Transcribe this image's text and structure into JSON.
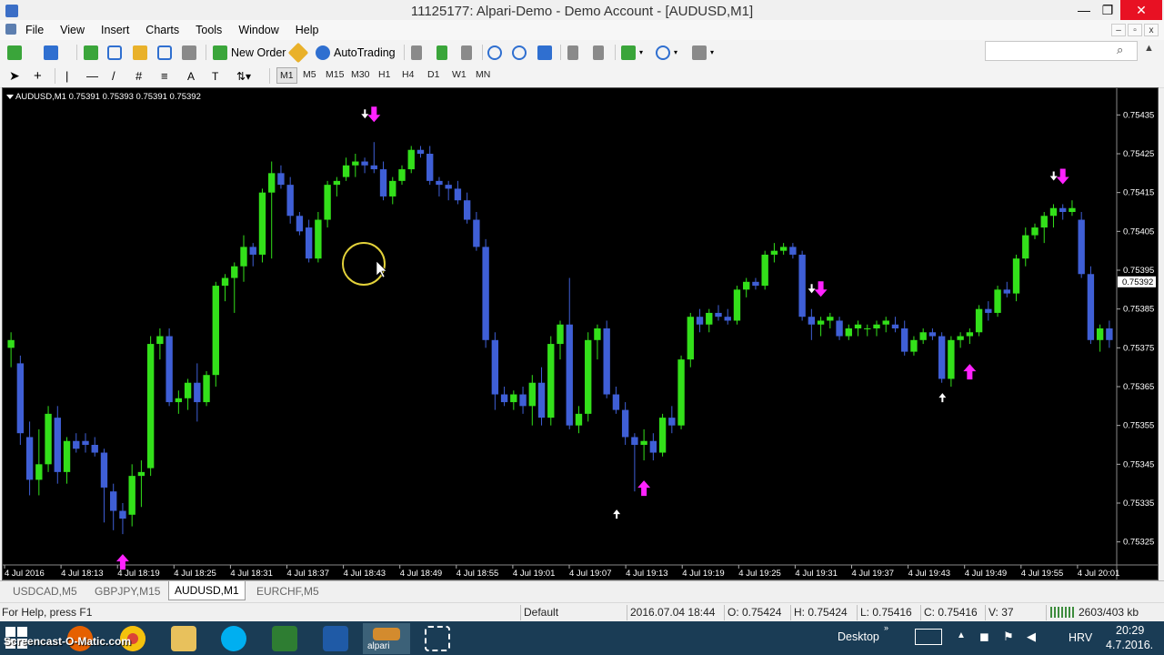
{
  "window": {
    "title": "11125177: Alpari-Demo - Demo Account - [AUDUSD,M1]",
    "controls": [
      "—",
      "❐",
      "✕"
    ]
  },
  "menu": [
    "File",
    "View",
    "Insert",
    "Charts",
    "Tools",
    "Window",
    "Help"
  ],
  "toolbar": {
    "new_order": "New Order",
    "autotrading": "AutoTrading"
  },
  "timeframes": [
    "M1",
    "M5",
    "M15",
    "M30",
    "H1",
    "H4",
    "D1",
    "W1",
    "MN"
  ],
  "active_timeframe": "M1",
  "search": {
    "placeholder": ""
  },
  "chart": {
    "symbol_label": "AUDUSD,M1  0.75391 0.75393 0.75391 0.75392",
    "current_price": "0.75392",
    "colors": {
      "background": "#000000",
      "bull": "#33e01a",
      "bear": "#3f5fd6",
      "arrow": "#ff22ff",
      "axis_text": "#ffffff"
    }
  },
  "chart_data": {
    "type": "candlestick",
    "title": "AUDUSD,M1",
    "y_ticks": [
      "0.75435",
      "0.75425",
      "0.75415",
      "0.75405",
      "0.75395",
      "0.75385",
      "0.75375",
      "0.75365",
      "0.75355",
      "0.75345",
      "0.75335",
      "0.75325"
    ],
    "x_ticks": [
      "4 Jul 2016",
      "4 Jul 18:13",
      "4 Jul 18:19",
      "4 Jul 18:25",
      "4 Jul 18:31",
      "4 Jul 18:37",
      "4 Jul 18:43",
      "4 Jul 18:49",
      "4 Jul 18:55",
      "4 Jul 19:01",
      "4 Jul 19:07",
      "4 Jul 19:13",
      "4 Jul 19:19",
      "4 Jul 19:25",
      "4 Jul 19:31",
      "4 Jul 19:37",
      "4 Jul 19:43",
      "4 Jul 19:49",
      "4 Jul 19:55",
      "4 Jul 20:01"
    ],
    "ylim": [
      0.7532,
      0.7544
    ],
    "ohlc": [
      [
        0.75375,
        0.75379,
        0.7537,
        0.75377
      ],
      [
        0.75371,
        0.75373,
        0.7535,
        0.75353
      ],
      [
        0.75352,
        0.75356,
        0.75337,
        0.75341
      ],
      [
        0.75341,
        0.75354,
        0.75337,
        0.75345
      ],
      [
        0.75345,
        0.7536,
        0.75343,
        0.75358
      ],
      [
        0.75357,
        0.7536,
        0.7534,
        0.75343
      ],
      [
        0.75343,
        0.75352,
        0.7534,
        0.75351
      ],
      [
        0.75351,
        0.75353,
        0.75348,
        0.75349
      ],
      [
        0.75351,
        0.75353,
        0.75348,
        0.7535
      ],
      [
        0.7535,
        0.75352,
        0.75347,
        0.75348
      ],
      [
        0.75348,
        0.75349,
        0.7533,
        0.75339
      ],
      [
        0.75338,
        0.7534,
        0.75328,
        0.75333
      ],
      [
        0.75333,
        0.75335,
        0.75327,
        0.75331
      ],
      [
        0.75332,
        0.75345,
        0.75329,
        0.75342
      ],
      [
        0.75342,
        0.75346,
        0.75334,
        0.75343
      ],
      [
        0.75344,
        0.75378,
        0.75342,
        0.75376
      ],
      [
        0.75376,
        0.7538,
        0.75372,
        0.75378
      ],
      [
        0.75378,
        0.7538,
        0.7536,
        0.75361
      ],
      [
        0.75361,
        0.75364,
        0.75358,
        0.75362
      ],
      [
        0.75362,
        0.75367,
        0.75359,
        0.75366
      ],
      [
        0.75366,
        0.75371,
        0.75356,
        0.75361
      ],
      [
        0.75361,
        0.75369,
        0.7536,
        0.75368
      ],
      [
        0.75368,
        0.75392,
        0.75365,
        0.75391
      ],
      [
        0.75391,
        0.75394,
        0.75387,
        0.75393
      ],
      [
        0.75393,
        0.75397,
        0.75384,
        0.75396
      ],
      [
        0.75396,
        0.75404,
        0.75392,
        0.75401
      ],
      [
        0.75401,
        0.75402,
        0.75396,
        0.75399
      ],
      [
        0.75399,
        0.75416,
        0.75397,
        0.75415
      ],
      [
        0.75415,
        0.75423,
        0.75398,
        0.7542
      ],
      [
        0.7542,
        0.75422,
        0.75416,
        0.75417
      ],
      [
        0.75417,
        0.75419,
        0.75407,
        0.75409
      ],
      [
        0.75409,
        0.7541,
        0.75404,
        0.75405
      ],
      [
        0.75406,
        0.75408,
        0.75397,
        0.75398
      ],
      [
        0.75398,
        0.7541,
        0.75397,
        0.75408
      ],
      [
        0.75408,
        0.75418,
        0.75406,
        0.75417
      ],
      [
        0.75417,
        0.75419,
        0.75414,
        0.75418
      ],
      [
        0.75419,
        0.75424,
        0.75418,
        0.75422
      ],
      [
        0.75422,
        0.75425,
        0.75419,
        0.75423
      ],
      [
        0.75423,
        0.75424,
        0.7542,
        0.75422
      ],
      [
        0.75422,
        0.75428,
        0.7542,
        0.75421
      ],
      [
        0.75421,
        0.75423,
        0.75413,
        0.75414
      ],
      [
        0.75414,
        0.75419,
        0.75412,
        0.75418
      ],
      [
        0.75418,
        0.75422,
        0.75417,
        0.75421
      ],
      [
        0.75421,
        0.75427,
        0.7542,
        0.75426
      ],
      [
        0.75426,
        0.75427,
        0.75424,
        0.75425
      ],
      [
        0.75425,
        0.75427,
        0.75417,
        0.75418
      ],
      [
        0.75418,
        0.75419,
        0.75414,
        0.75417
      ],
      [
        0.75417,
        0.75418,
        0.75413,
        0.75416
      ],
      [
        0.75416,
        0.75418,
        0.75412,
        0.75413
      ],
      [
        0.75413,
        0.75415,
        0.75407,
        0.75408
      ],
      [
        0.75408,
        0.7541,
        0.754,
        0.75401
      ],
      [
        0.75401,
        0.75403,
        0.75375,
        0.75377
      ],
      [
        0.75377,
        0.75379,
        0.75359,
        0.75363
      ],
      [
        0.75363,
        0.75365,
        0.7536,
        0.75361
      ],
      [
        0.75361,
        0.75364,
        0.75359,
        0.75363
      ],
      [
        0.75363,
        0.75365,
        0.75358,
        0.7536
      ],
      [
        0.7536,
        0.75368,
        0.75355,
        0.75366
      ],
      [
        0.75366,
        0.7537,
        0.75355,
        0.75357
      ],
      [
        0.75357,
        0.75378,
        0.75355,
        0.75376
      ],
      [
        0.75376,
        0.75382,
        0.75372,
        0.75381
      ],
      [
        0.75381,
        0.75393,
        0.75354,
        0.75355
      ],
      [
        0.75355,
        0.7536,
        0.75353,
        0.75358
      ],
      [
        0.75358,
        0.75379,
        0.75356,
        0.75377
      ],
      [
        0.75377,
        0.75381,
        0.75372,
        0.7538
      ],
      [
        0.7538,
        0.75382,
        0.75362,
        0.75363
      ],
      [
        0.75363,
        0.75365,
        0.75358,
        0.75359
      ],
      [
        0.75359,
        0.75361,
        0.7535,
        0.75352
      ],
      [
        0.75352,
        0.75353,
        0.75338,
        0.7535
      ],
      [
        0.7535,
        0.75354,
        0.75346,
        0.75351
      ],
      [
        0.75351,
        0.75353,
        0.75346,
        0.75348
      ],
      [
        0.75348,
        0.75358,
        0.75347,
        0.75357
      ],
      [
        0.75357,
        0.7536,
        0.75353,
        0.75355
      ],
      [
        0.75355,
        0.75373,
        0.75354,
        0.75372
      ],
      [
        0.75372,
        0.75384,
        0.7537,
        0.75383
      ],
      [
        0.75383,
        0.75385,
        0.75379,
        0.75381
      ],
      [
        0.75381,
        0.75385,
        0.75379,
        0.75384
      ],
      [
        0.75384,
        0.75386,
        0.75382,
        0.75383
      ],
      [
        0.75383,
        0.75385,
        0.75381,
        0.75382
      ],
      [
        0.75382,
        0.75391,
        0.75381,
        0.7539
      ],
      [
        0.7539,
        0.75393,
        0.75388,
        0.75392
      ],
      [
        0.75392,
        0.75393,
        0.7539,
        0.75391
      ],
      [
        0.75391,
        0.754,
        0.7539,
        0.75399
      ],
      [
        0.75399,
        0.75402,
        0.75397,
        0.754
      ],
      [
        0.754,
        0.75402,
        0.75399,
        0.75401
      ],
      [
        0.75401,
        0.75402,
        0.75398,
        0.75399
      ],
      [
        0.75399,
        0.754,
        0.75382,
        0.75383
      ],
      [
        0.75383,
        0.75385,
        0.75377,
        0.75381
      ],
      [
        0.75381,
        0.75383,
        0.75378,
        0.75382
      ],
      [
        0.75382,
        0.75384,
        0.7538,
        0.75383
      ],
      [
        0.75382,
        0.75383,
        0.75377,
        0.75378
      ],
      [
        0.75378,
        0.75381,
        0.75377,
        0.7538
      ],
      [
        0.7538,
        0.75382,
        0.75378,
        0.75381
      ],
      [
        0.7538,
        0.75381,
        0.75378,
        0.7538
      ],
      [
        0.7538,
        0.75382,
        0.75378,
        0.75381
      ],
      [
        0.75381,
        0.75383,
        0.75379,
        0.75382
      ],
      [
        0.75381,
        0.75383,
        0.75379,
        0.7538
      ],
      [
        0.7538,
        0.75382,
        0.75373,
        0.75374
      ],
      [
        0.75374,
        0.75378,
        0.75373,
        0.75377
      ],
      [
        0.75377,
        0.7538,
        0.75376,
        0.75379
      ],
      [
        0.75379,
        0.7538,
        0.75377,
        0.75378
      ],
      [
        0.75378,
        0.75379,
        0.75366,
        0.75367
      ],
      [
        0.75367,
        0.75378,
        0.75365,
        0.75377
      ],
      [
        0.75377,
        0.75379,
        0.75375,
        0.75378
      ],
      [
        0.75378,
        0.7538,
        0.75376,
        0.75379
      ],
      [
        0.75379,
        0.75386,
        0.75378,
        0.75385
      ],
      [
        0.75385,
        0.75387,
        0.75382,
        0.75384
      ],
      [
        0.75384,
        0.75391,
        0.75383,
        0.7539
      ],
      [
        0.7539,
        0.75392,
        0.75388,
        0.75389
      ],
      [
        0.75389,
        0.75399,
        0.75387,
        0.75398
      ],
      [
        0.75398,
        0.75406,
        0.75396,
        0.75404
      ],
      [
        0.75404,
        0.75407,
        0.75403,
        0.75406
      ],
      [
        0.75406,
        0.7541,
        0.75402,
        0.75409
      ],
      [
        0.75409,
        0.75412,
        0.75406,
        0.75411
      ],
      [
        0.75411,
        0.75412,
        0.75408,
        0.7541
      ],
      [
        0.7541,
        0.75413,
        0.75409,
        0.75411
      ],
      [
        0.75408,
        0.7541,
        0.75393,
        0.75394
      ],
      [
        0.75394,
        0.75396,
        0.75376,
        0.75377
      ],
      [
        0.75377,
        0.75381,
        0.75374,
        0.7538
      ],
      [
        0.7538,
        0.75382,
        0.75375,
        0.75377
      ]
    ],
    "signals": [
      {
        "bar": 12,
        "dir": "up"
      },
      {
        "bar": 39,
        "dir": "down"
      },
      {
        "bar": 68,
        "dir": "up"
      },
      {
        "bar": 87,
        "dir": "down"
      },
      {
        "bar": 103,
        "dir": "up"
      },
      {
        "bar": 113,
        "dir": "down"
      }
    ]
  },
  "tabs": [
    "USDCAD,M5",
    "GBPJPY,M15",
    "AUDUSD,M1",
    "EURCHF,M5"
  ],
  "active_tab": "AUDUSD,M1",
  "status": {
    "help": "For Help, press F1",
    "profile": "Default",
    "datetime": "2016.07.04 18:44",
    "open": "O: 0.75424",
    "high": "H: 0.75424",
    "low": "L: 0.75416",
    "close": "C: 0.75416",
    "volume": "V: 37",
    "traffic": "2603/403 kb"
  },
  "taskbar": {
    "watermark": "Screencast-O-Matic.com",
    "alpari_label": "alpari",
    "desktop": "Desktop",
    "lang": "HRV",
    "time": "20:29",
    "date": "4.7.2016."
  }
}
